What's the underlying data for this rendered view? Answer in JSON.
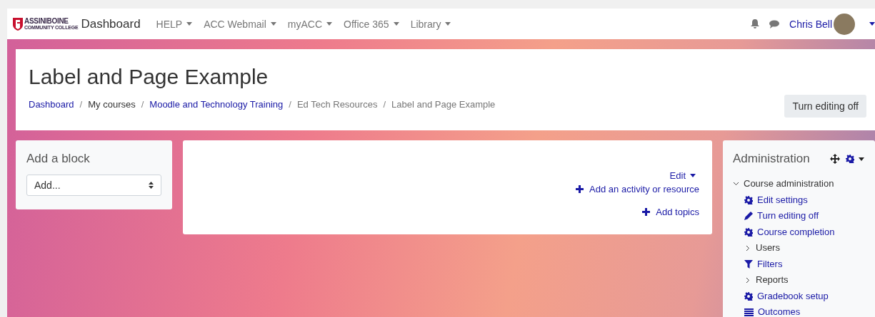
{
  "navbar": {
    "logo_lines": [
      "ASSINIBOINE",
      "COMMUNITY COLLEGE"
    ],
    "brand": "Dashboard",
    "menus": [
      {
        "label": "HELP"
      },
      {
        "label": "ACC Webmail"
      },
      {
        "label": "myACC"
      },
      {
        "label": "Office 365"
      },
      {
        "label": "Library"
      }
    ],
    "user_name": "Chris Bell"
  },
  "header": {
    "title": "Label and Page Example",
    "breadcrumbs": [
      {
        "label": "Dashboard",
        "link": true
      },
      {
        "label": "My courses",
        "link": false
      },
      {
        "label": "Moodle and Technology Training",
        "link": true
      },
      {
        "label": "Ed Tech Resources",
        "link": false
      },
      {
        "label": "Label and Page Example",
        "link": false
      }
    ],
    "separator": "/",
    "button": "Turn editing off"
  },
  "add_block": {
    "title": "Add a block",
    "select": "Add..."
  },
  "course_section": {
    "edit_menu": "Edit",
    "actions": [
      {
        "label": "Add an activity or resource"
      },
      {
        "label": "Add topics"
      }
    ]
  },
  "administration": {
    "title": "Administration",
    "tree": [
      {
        "label": "Course administration",
        "kind": "node",
        "expanded": true,
        "children": [
          {
            "label": "Edit settings",
            "kind": "gear"
          },
          {
            "label": "Turn editing off",
            "kind": "pencil"
          },
          {
            "label": "Course completion",
            "kind": "gear"
          },
          {
            "label": "Users",
            "kind": "node",
            "expanded": false
          },
          {
            "label": "Filters",
            "kind": "filter"
          },
          {
            "label": "Reports",
            "kind": "node",
            "expanded": false
          },
          {
            "label": "Gradebook setup",
            "kind": "gear"
          },
          {
            "label": "Outcomes",
            "kind": "list"
          }
        ]
      }
    ]
  }
}
